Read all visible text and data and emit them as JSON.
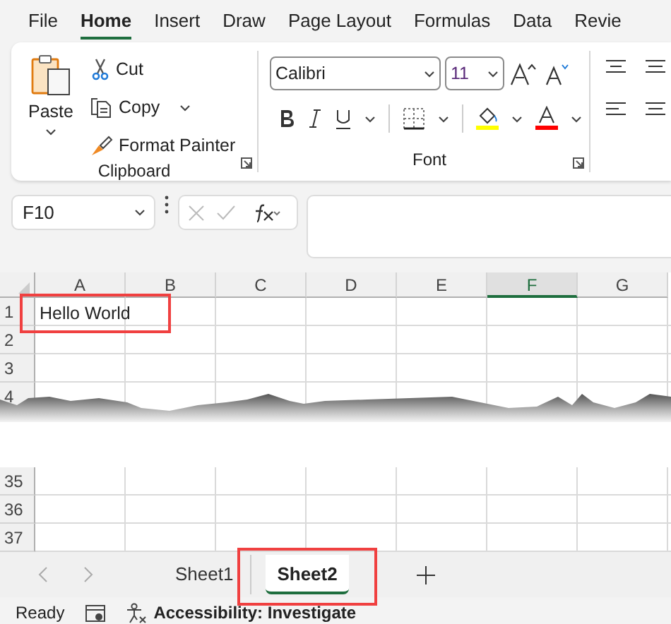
{
  "menu_tabs": [
    {
      "label": "File",
      "selected": false
    },
    {
      "label": "Home",
      "selected": true
    },
    {
      "label": "Insert",
      "selected": false
    },
    {
      "label": "Draw",
      "selected": false
    },
    {
      "label": "Page Layout",
      "selected": false
    },
    {
      "label": "Formulas",
      "selected": false
    },
    {
      "label": "Data",
      "selected": false
    },
    {
      "label": "Revie",
      "selected": false
    }
  ],
  "clipboard": {
    "label": "Clipboard",
    "paste": "Paste",
    "cut": "Cut",
    "copy": "Copy",
    "format_painter": "Format Painter"
  },
  "font": {
    "label": "Font",
    "font_name": "Calibri",
    "font_size": "11"
  },
  "formula_bar": {
    "name_box": "F10"
  },
  "columns": [
    {
      "label": "A",
      "selected": false
    },
    {
      "label": "B",
      "selected": false
    },
    {
      "label": "C",
      "selected": false
    },
    {
      "label": "D",
      "selected": false
    },
    {
      "label": "E",
      "selected": false
    },
    {
      "label": "F",
      "selected": true
    },
    {
      "label": "G",
      "selected": false
    }
  ],
  "rows": [
    {
      "label": "1",
      "cells": [
        "Hello World"
      ]
    },
    {
      "label": "2"
    },
    {
      "label": "3"
    },
    {
      "label": "4"
    }
  ],
  "rows_after_break": [
    {
      "label": "35"
    },
    {
      "label": "36"
    },
    {
      "label": "37"
    }
  ],
  "sheet_tabs": [
    {
      "label": "Sheet1",
      "selected": false
    },
    {
      "label": "Sheet2",
      "selected": true
    }
  ],
  "status_bar": {
    "status": "Ready",
    "accessibility": "Accessibility: Investigate"
  }
}
